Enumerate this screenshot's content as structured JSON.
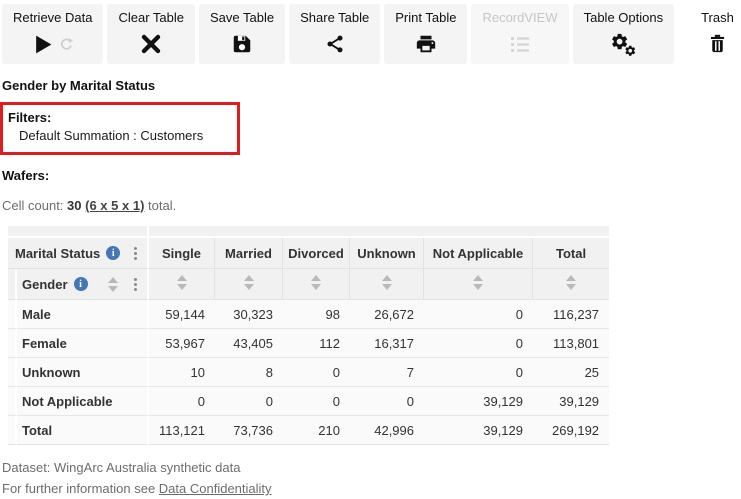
{
  "toolbar": {
    "buttons": [
      {
        "label": "Retrieve Data",
        "icon": "play-icon+refresh-icon",
        "disabled": false
      },
      {
        "label": "Clear Table",
        "icon": "x-icon",
        "disabled": false
      },
      {
        "label": "Save Table",
        "icon": "floppy-icon",
        "disabled": false
      },
      {
        "label": "Share Table",
        "icon": "share-icon",
        "disabled": false
      },
      {
        "label": "Print Table",
        "icon": "printer-icon",
        "disabled": false
      },
      {
        "label": "RecordVIEW",
        "icon": "list-icon",
        "disabled": true
      },
      {
        "label": "Table Options",
        "icon": "gears-icon",
        "disabled": false
      },
      {
        "label": "Trash",
        "icon": "trash-icon",
        "disabled": false
      }
    ]
  },
  "page": {
    "title": "Gender by Marital Status"
  },
  "filters": {
    "heading": "Filters:",
    "item": "Default Summation : Customers"
  },
  "wafers": {
    "label": "Wafers:"
  },
  "cell_count": {
    "prefix": "Cell count: ",
    "count": "30",
    "link": "(6 x 5 x 1)",
    "suffix": " total."
  },
  "table": {
    "column_variable": "Marital Status",
    "row_variable": "Gender",
    "columns": [
      "Single",
      "Married",
      "Divorced",
      "Unknown",
      "Not Applicable",
      "Total"
    ],
    "rows": [
      {
        "label": "Male",
        "values": [
          "59,144",
          "30,323",
          "98",
          "26,672",
          "0",
          "116,237"
        ]
      },
      {
        "label": "Female",
        "values": [
          "53,967",
          "43,405",
          "112",
          "16,317",
          "0",
          "113,801"
        ]
      },
      {
        "label": "Unknown",
        "values": [
          "10",
          "8",
          "0",
          "7",
          "0",
          "25"
        ]
      },
      {
        "label": "Not Applicable",
        "values": [
          "0",
          "0",
          "0",
          "0",
          "39,129",
          "39,129"
        ]
      },
      {
        "label": "Total",
        "values": [
          "113,121",
          "73,736",
          "210",
          "42,996",
          "39,129",
          "269,192"
        ]
      }
    ]
  },
  "footer": {
    "dataset_line": "Dataset: WingArc Australia synthetic data",
    "info_prefix": "For further information see ",
    "info_link": "Data Confidentiality"
  },
  "colors": {
    "accent_red": "#e01d1d",
    "info_blue": "#4377b6",
    "button_bg": "#f4f4f4",
    "header_bg": "#f1f1f1"
  }
}
